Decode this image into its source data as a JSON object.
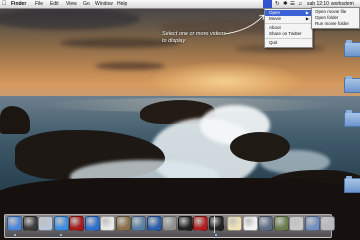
{
  "menubar": {
    "apple": "",
    "app_name": "Finder",
    "menus": [
      "File",
      "Edit",
      "View",
      "Go",
      "Window",
      "Help"
    ],
    "clock": "sab 12:10",
    "user": "worksdem"
  },
  "menu": {
    "items": [
      {
        "label": "Open",
        "has_submenu": true,
        "highlighted": true
      },
      {
        "label": "Movie",
        "has_submenu": true,
        "highlighted": false
      },
      {
        "label": "About",
        "has_submenu": false,
        "highlighted": false
      },
      {
        "label": "Share on Twitter",
        "has_submenu": false,
        "highlighted": false
      },
      {
        "label": "Quit",
        "has_submenu": false,
        "highlighted": false
      }
    ],
    "submenu": [
      "Open movie file",
      "Open folder",
      "Run movie folder"
    ]
  },
  "annotation": {
    "line1": "Select one or more videos",
    "line2": "to display"
  },
  "colors": {
    "menu_highlight": "#3b63d6",
    "menubar_bg": "#e8e8e8"
  },
  "dock": {
    "items": [
      {
        "name": "finder-icon",
        "color": "#4a86d8"
      },
      {
        "name": "dashboard-icon",
        "color": "#3a3a3a"
      },
      {
        "name": "mail-icon",
        "color": "#b9c7d8"
      },
      {
        "name": "safari-icon",
        "color": "#3c8ee0"
      },
      {
        "name": "photo-booth-icon",
        "color": "#a61a1a"
      },
      {
        "name": "itunes-icon",
        "color": "#2d6fd0"
      },
      {
        "name": "ical-icon",
        "color": "#e9e9e9"
      },
      {
        "name": "address-book-icon",
        "color": "#8a6f4a"
      },
      {
        "name": "preview-icon",
        "color": "#5a7fa5"
      },
      {
        "name": "network-icon",
        "color": "#2b5faa"
      },
      {
        "name": "system-prefs-icon",
        "color": "#8f8f8f"
      },
      {
        "name": "camera-icon",
        "color": "#222222"
      },
      {
        "name": "app-red-icon",
        "color": "#b31d1d"
      },
      {
        "name": "clapperboard-icon",
        "color": "#222222"
      },
      {
        "name": "textedit-icon",
        "color": "#f0e2b6"
      },
      {
        "name": "calendar-icon",
        "color": "#f2f2f2"
      },
      {
        "name": "itunes-store-icon",
        "color": "#5c6e86"
      },
      {
        "name": "time-machine-icon",
        "color": "#6a7d4b"
      },
      {
        "name": "system-settings-icon",
        "color": "#c9c9c9"
      },
      {
        "name": "documents-stack-icon",
        "color": "#6f8fbf"
      },
      {
        "name": "trash-icon",
        "color": "#b8b8c0"
      }
    ]
  }
}
